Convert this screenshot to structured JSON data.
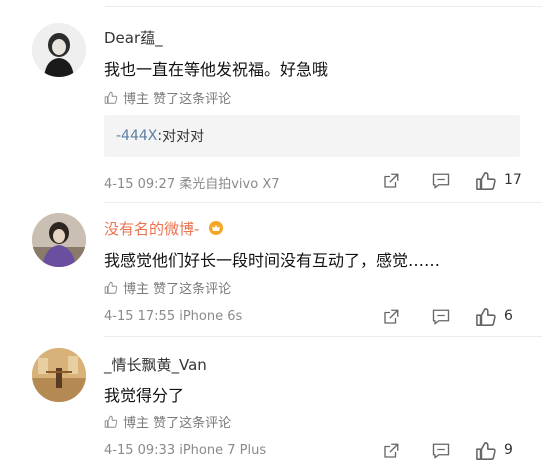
{
  "comments": [
    {
      "username": "Dear蕴_",
      "text": "我也一直在等他发祝福。好急哦",
      "liked_label": "博主 赞了这条评论",
      "reply": {
        "user": "-444X",
        "sep": ":",
        "text": " 对对对"
      },
      "meta": "4-15 09:27 柔光自拍vivo X7",
      "likes": "17"
    },
    {
      "username": "没有名的微博-",
      "text": "我感觉他们好长一段时间没有互动了，感觉……",
      "liked_label": "博主 赞了这条评论",
      "meta": "4-15 17:55 iPhone 6s",
      "likes": "6"
    },
    {
      "username": "_情长飘黄_Van",
      "text": "我觉得分了",
      "liked_label": "博主 赞了这条评论",
      "meta": "4-15 09:33 iPhone 7 Plus",
      "likes": "9"
    }
  ],
  "icons": {
    "like": "thumbs-up-icon",
    "forward": "forward-icon",
    "comment": "comment-icon",
    "badge": "vip-badge-icon"
  },
  "colors": {
    "username_highlight": "#eb7350",
    "reply_user": "#5b7fa6"
  }
}
